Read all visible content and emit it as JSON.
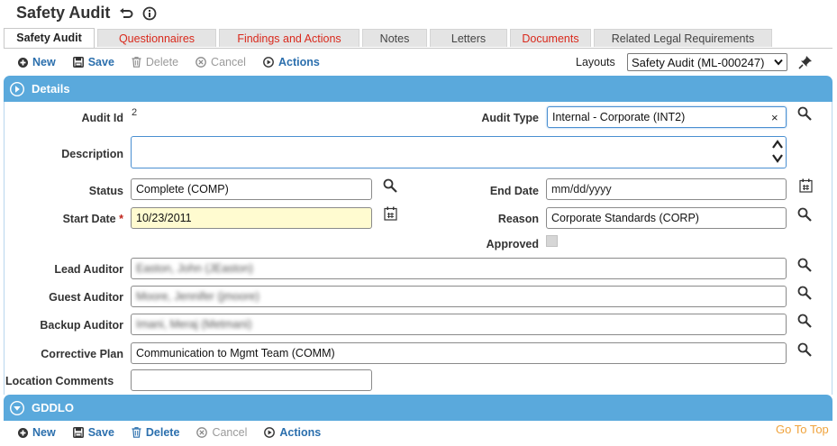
{
  "header": {
    "title": "Safety Audit"
  },
  "tabs": [
    {
      "label": "Safety Audit"
    },
    {
      "label": "Questionnaires"
    },
    {
      "label": "Findings and Actions"
    },
    {
      "label": "Notes"
    },
    {
      "label": "Letters"
    },
    {
      "label": "Documents"
    },
    {
      "label": "Related Legal Requirements"
    }
  ],
  "toolbar": {
    "new_label": "New",
    "save_label": "Save",
    "delete_label": "Delete",
    "cancel_label": "Cancel",
    "actions_label": "Actions",
    "layouts_label": "Layouts",
    "layout_selected": "Safety Audit (ML-000247)"
  },
  "sections": {
    "details": "Details",
    "gddlo": "GDDLO"
  },
  "form": {
    "audit_id_label": "Audit Id",
    "audit_id_value": "2",
    "audit_type_label": "Audit Type",
    "audit_type_value": "Internal - Corporate (INT2)",
    "description_label": "Description",
    "status_label": "Status",
    "status_value": "Complete (COMP)",
    "end_date_label": "End Date",
    "end_date_placeholder": "mm/dd/yyyy",
    "start_date_label": "Start Date",
    "start_date_value": "10/23/2011",
    "required_mark": "*",
    "reason_label": "Reason",
    "reason_value": "Corporate Standards (CORP)",
    "approved_label": "Approved",
    "lead_auditor_label": "Lead Auditor",
    "lead_auditor_value": "Easton, John (JEaston)",
    "guest_auditor_label": "Guest Auditor",
    "guest_auditor_value": "Moore, Jennifer (jmoore)",
    "backup_auditor_label": "Backup Auditor",
    "backup_auditor_value": "Imani, Meraj (Metmani)",
    "corrective_plan_label": "Corrective Plan",
    "corrective_plan_value": "Communication to Mgmt Team (COMM)",
    "location_comments_label": "Location Comments"
  },
  "footer": {
    "goto_top": "Go To Top"
  },
  "colors": {
    "accent": "#2b6fad",
    "section_bar": "#5aa9dc",
    "tab_alert": "#d9291c",
    "goto": "#f0a33c"
  }
}
